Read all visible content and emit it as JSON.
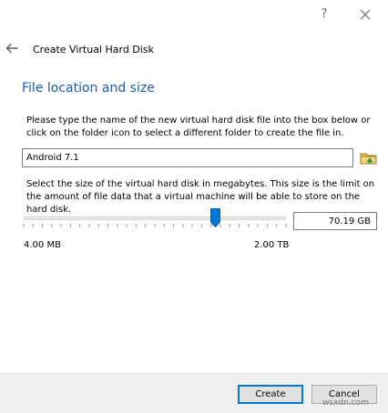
{
  "titlebar": {
    "help_label": "?",
    "close_icon": "close-icon"
  },
  "header": {
    "back_icon": "back-arrow-icon",
    "title": "Create Virtual Hard Disk"
  },
  "section": {
    "title": "File location and size"
  },
  "file_location": {
    "description": "Please type the name of the new virtual hard disk file into the box below or click on the folder icon to select a different folder to create the file in.",
    "value": "Android 7.1",
    "folder_icon": "folder-icon"
  },
  "file_size": {
    "description": "Select the size of the virtual hard disk in megabytes. This size is the limit on the amount of file data that a virtual machine will be able to store on the hard disk.",
    "value": "70.19 GB",
    "min_label": "4.00 MB",
    "max_label": "2.00 TB",
    "slider_fraction": 0.73
  },
  "buttons": {
    "create": "Create",
    "cancel": "Cancel"
  },
  "watermark": "wsxdn.com",
  "colors": {
    "accent": "#0078d7",
    "title_blue": "#1e5aa8",
    "footer_bg": "#f0f0f0"
  }
}
